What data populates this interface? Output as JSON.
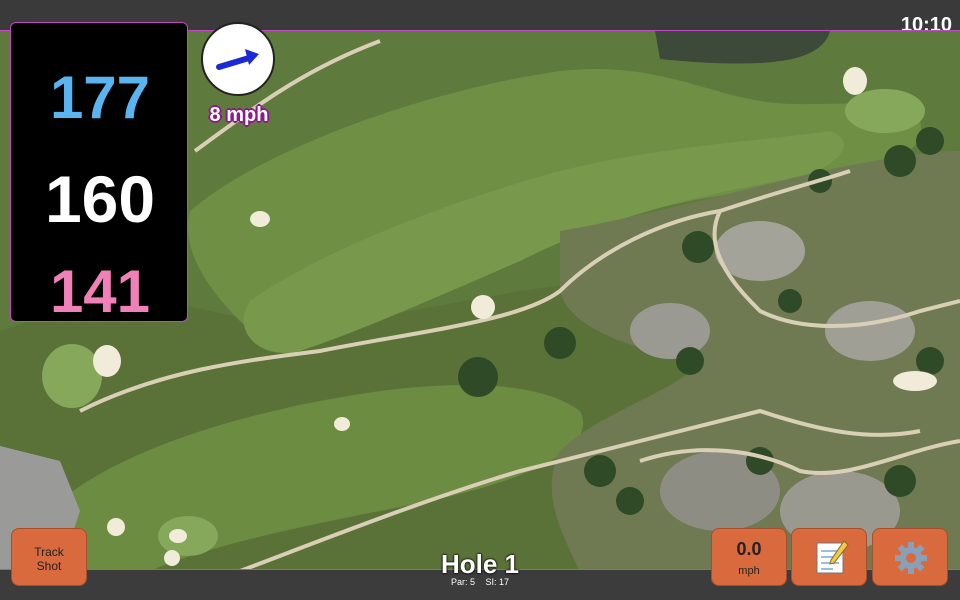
{
  "status_bar": {
    "time": "10:10"
  },
  "distances": {
    "back": "177",
    "center": "160",
    "front": "141"
  },
  "wind": {
    "speed": "8 mph",
    "icon": "wind-arrow-icon"
  },
  "buttons": {
    "track_shot_line1": "Track",
    "track_shot_line2": "Shot",
    "speed_value": "0.0",
    "speed_unit": "mph",
    "notes_icon": "notepad-icon",
    "settings_icon": "gear-icon"
  },
  "hole": {
    "title": "Hole 1",
    "par": "Par: 5",
    "si": "SI: 17"
  },
  "colors": {
    "back_distance": "#5ab4f0",
    "center_distance": "#ffffff",
    "front_distance": "#f080b8",
    "button": "#d96a3e",
    "accent_border": "#c04ac0"
  }
}
